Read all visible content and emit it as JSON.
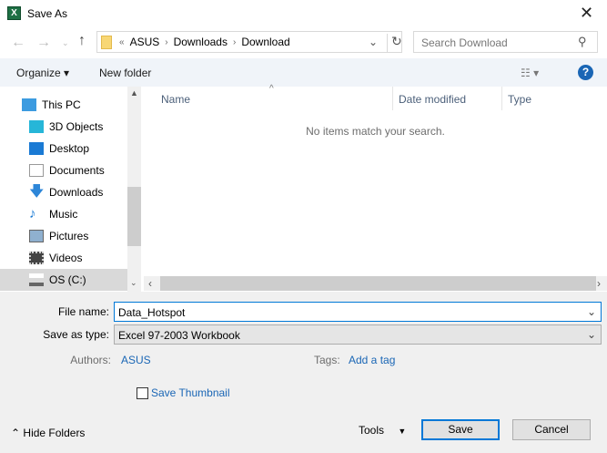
{
  "window": {
    "title": "Save As",
    "app_icon": "excel-icon"
  },
  "address": {
    "crumbs": [
      "ASUS",
      "Downloads",
      "Download"
    ],
    "overflow": "«"
  },
  "search": {
    "placeholder": "Search Download"
  },
  "toolbar": {
    "organize": "Organize ▾",
    "new_folder": "New folder",
    "help": "?"
  },
  "nav_pane": {
    "items": [
      {
        "label": "This PC",
        "icon": "computer-icon",
        "color": "#3c9be0"
      },
      {
        "label": "3D Objects",
        "icon": "cube-icon",
        "color": "#26b6d8"
      },
      {
        "label": "Desktop",
        "icon": "desktop-icon",
        "color": "#1a7ad4"
      },
      {
        "label": "Documents",
        "icon": "document-icon",
        "color": "#9aa"
      },
      {
        "label": "Downloads",
        "icon": "download-arrow-icon",
        "color": "#2d86d8"
      },
      {
        "label": "Music",
        "icon": "music-note-icon",
        "color": "#1a7ad4"
      },
      {
        "label": "Pictures",
        "icon": "pictures-icon",
        "color": "#6a8fb5"
      },
      {
        "label": "Videos",
        "icon": "film-icon",
        "color": "#444"
      },
      {
        "label": "OS (C:)",
        "icon": "drive-icon",
        "color": "#888"
      }
    ],
    "selected": "OS (C:)"
  },
  "file_list": {
    "columns": [
      "Name",
      "Date modified",
      "Type"
    ],
    "empty_message": "No items match your search."
  },
  "form": {
    "file_name_label": "File name:",
    "file_name_value": "Data_Hotspot",
    "save_type_label": "Save as type:",
    "save_type_value": "Excel 97-2003 Workbook",
    "authors_label": "Authors:",
    "authors_value": "ASUS",
    "tags_label": "Tags:",
    "tags_value": "Add a tag",
    "thumbnail_label": "Save Thumbnail",
    "thumbnail_checked": false
  },
  "footer": {
    "hide_folders": "Hide Folders",
    "tools": "Tools",
    "save": "Save",
    "cancel": "Cancel"
  }
}
